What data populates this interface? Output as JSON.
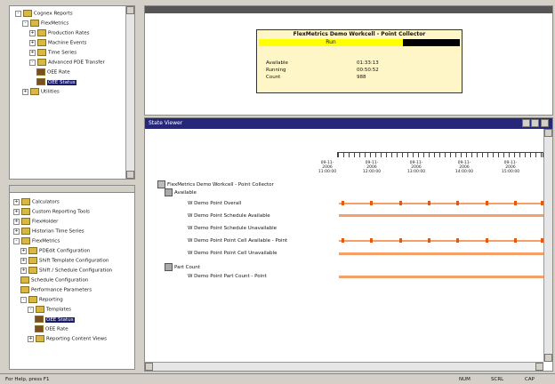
{
  "colors": {
    "titlebar": "#27277a",
    "highlight": "#ffff00",
    "gantt": "#f4a06a",
    "marker": "#e25a10",
    "bg": "#d4d0c8"
  },
  "top_tree": {
    "items": [
      {
        "label": "Cognex Reports",
        "level": 0,
        "expander": "-",
        "icon": "folder-icon"
      },
      {
        "label": "FlexMetrics",
        "level": 1,
        "expander": "-",
        "icon": "folder-icon"
      },
      {
        "label": "Production Rates",
        "level": 2,
        "expander": "+",
        "icon": "folder-icon"
      },
      {
        "label": "Machine Events",
        "level": 2,
        "expander": "+",
        "icon": "folder-icon"
      },
      {
        "label": "Time Series",
        "level": 2,
        "expander": "+",
        "icon": "folder-icon"
      },
      {
        "label": "Advanced PDE Transfer",
        "level": 2,
        "expander": "-",
        "icon": "folder-icon"
      },
      {
        "label": "OEE Rate",
        "level": 3,
        "expander": "",
        "icon": "report-icon"
      },
      {
        "label": "OEE Status",
        "level": 3,
        "expander": "",
        "icon": "report-icon",
        "selected": true
      },
      {
        "label": "Utilities",
        "level": 1,
        "expander": "+",
        "icon": "folder-icon"
      }
    ]
  },
  "bottom_tree": {
    "items": [
      {
        "label": "Calculators",
        "level": 0,
        "expander": "+",
        "icon": "calc-icon"
      },
      {
        "label": "Custom Reporting Tools",
        "level": 0,
        "expander": "+",
        "icon": "tools-icon"
      },
      {
        "label": "FlexHolder",
        "level": 0,
        "expander": "+",
        "icon": "folder-icon"
      },
      {
        "label": "Historian Time Series",
        "level": 0,
        "expander": "+",
        "icon": "chart-icon"
      },
      {
        "label": "FlexMetrics",
        "level": 0,
        "expander": "-",
        "icon": "folder-icon"
      },
      {
        "label": "PDEdit Configuration",
        "level": 1,
        "expander": "+",
        "icon": "config-icon"
      },
      {
        "label": "Shift Template Configuration",
        "level": 1,
        "expander": "+",
        "icon": "config-icon"
      },
      {
        "label": "Shift / Schedule Configuration",
        "level": 1,
        "expander": "+",
        "icon": "config-icon"
      },
      {
        "label": "Schedule Configuration",
        "level": 1,
        "expander": "",
        "icon": "config-icon"
      },
      {
        "label": "Performance Parameters",
        "level": 1,
        "expander": "",
        "icon": "config-icon"
      },
      {
        "label": "Reporting",
        "level": 1,
        "expander": "-",
        "icon": "folder-icon"
      },
      {
        "label": "Templates",
        "level": 2,
        "expander": "-",
        "icon": "folder-icon"
      },
      {
        "label": "OEE Status",
        "level": 3,
        "expander": "",
        "icon": "report-icon",
        "selected": true
      },
      {
        "label": "OEE Rate",
        "level": 3,
        "expander": "",
        "icon": "report-icon"
      },
      {
        "label": "Reporting Content Views",
        "level": 2,
        "expander": "+",
        "icon": "folder-icon"
      }
    ]
  },
  "status_panel": {
    "title": "FlexMetrics Demo Workcell - Point Collector",
    "state": "Run",
    "rows": [
      {
        "label": "Available",
        "value": "01:33:13"
      },
      {
        "label": "Running",
        "value": "00:50:52"
      },
      {
        "label": "Count",
        "value": "988"
      }
    ]
  },
  "state_viewer": {
    "title": "State Viewer",
    "root_label": "FlexMetrics Demo Workcell - Point Collector",
    "groups": [
      {
        "label": "Available",
        "rows": [
          "W Demo Point Overall",
          "W Demo Point Schedule Available",
          "W Demo Point Schedule Unavailable",
          "W Demo Point Point Cell Available - Point",
          "W Demo Point Point Cell Unavailable"
        ]
      },
      {
        "label": "Part Count",
        "rows": [
          "W Demo Point Part Count - Point"
        ]
      }
    ],
    "dates": [
      "09-11-2006 11:00:00",
      "09-11-2006 12:00:00",
      "09-11-2006 13:00:00",
      "09-11-2006 14:00:00",
      "09-11-2006 15:00:00"
    ]
  },
  "status_bar": {
    "left": "For Help, press F1",
    "cells": [
      "NUM",
      "SCRL",
      "CAP"
    ]
  }
}
